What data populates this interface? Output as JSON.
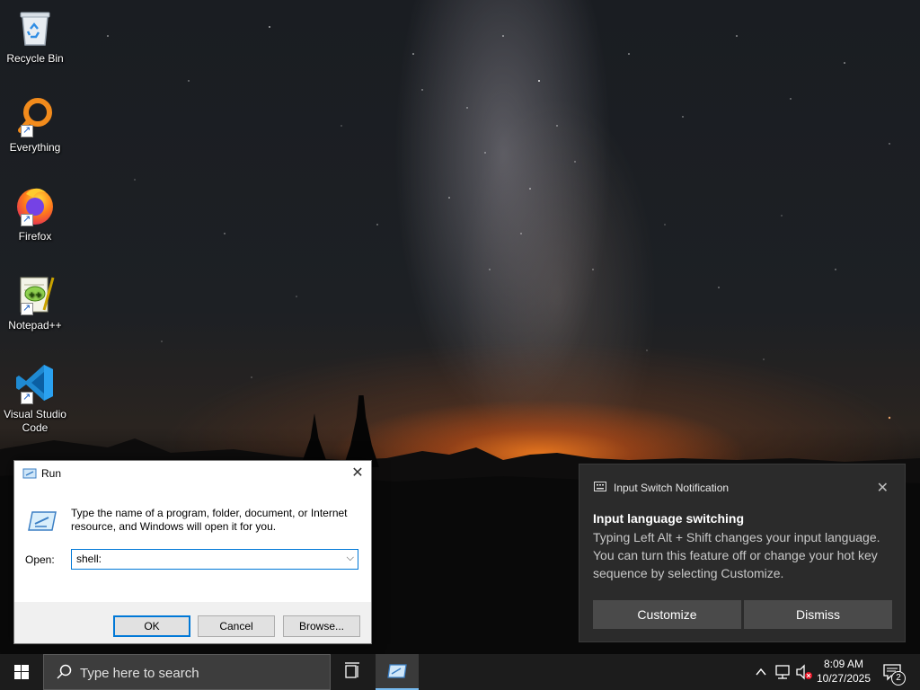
{
  "desktop": {
    "icons": [
      {
        "label": "Recycle Bin",
        "icon": "recycle-bin-icon"
      },
      {
        "label": "Everything",
        "icon": "everything-search-icon"
      },
      {
        "label": "Firefox",
        "icon": "firefox-icon"
      },
      {
        "label": "Notepad++",
        "icon": "notepad-plus-plus-icon"
      },
      {
        "label": "Visual Studio Code",
        "icon": "vscode-icon"
      }
    ]
  },
  "run_dialog": {
    "title": "Run",
    "description": "Type the name of a program, folder, document, or Internet resource, and Windows will open it for you.",
    "open_label": "Open:",
    "open_value": "shell:",
    "ok_label": "OK",
    "cancel_label": "Cancel",
    "browse_label": "Browse..."
  },
  "notification": {
    "app_name": "Input Switch Notification",
    "title": "Input language switching",
    "body": "Typing Left Alt + Shift changes your input language. You can turn this feature off or change your hot key sequence by selecting Customize.",
    "customize_label": "Customize",
    "dismiss_label": "Dismiss"
  },
  "taskbar": {
    "search_placeholder": "Type here to search",
    "time": "8:09 AM",
    "date": "10/27/2025",
    "notification_count": "2"
  },
  "colors": {
    "accent": "#0078d7",
    "taskbar_bg": "#1c1c1c",
    "toast_bg": "#2b2b2b",
    "toast_button": "#4a4a4a"
  }
}
